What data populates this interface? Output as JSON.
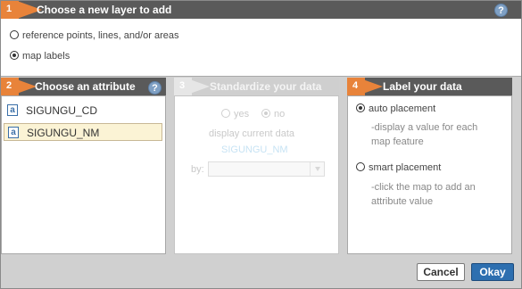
{
  "step1": {
    "number": "1",
    "title": "Choose a new layer to add",
    "options": [
      "reference points, lines, and/or areas",
      "map labels"
    ],
    "selected": 1
  },
  "step2": {
    "number": "2",
    "title": "Choose an attribute",
    "attributes": [
      "SIGUNGU_CD",
      "SIGUNGU_NM"
    ],
    "selected": 1
  },
  "step3": {
    "number": "3",
    "title": "Standardize your data",
    "yes_label": "yes",
    "no_label": "no",
    "display_text": "display current data",
    "current_field": "SIGUNGU_NM",
    "by_label": "by:"
  },
  "step4": {
    "number": "4",
    "title": "Label your data",
    "auto_label": "auto placement",
    "auto_desc_1": "-display a value for each",
    "auto_desc_2": "map feature",
    "smart_label": "smart placement",
    "smart_desc_1": "-click the map to add an",
    "smart_desc_2": "attribute value"
  },
  "help_glyph": "?",
  "buttons": {
    "cancel": "Cancel",
    "okay": "Okay"
  },
  "colors": {
    "accent": "#e8833a",
    "header": "#5a5a5a",
    "ok_button": "#2d6fb0",
    "selection": "#fbf3d5"
  }
}
